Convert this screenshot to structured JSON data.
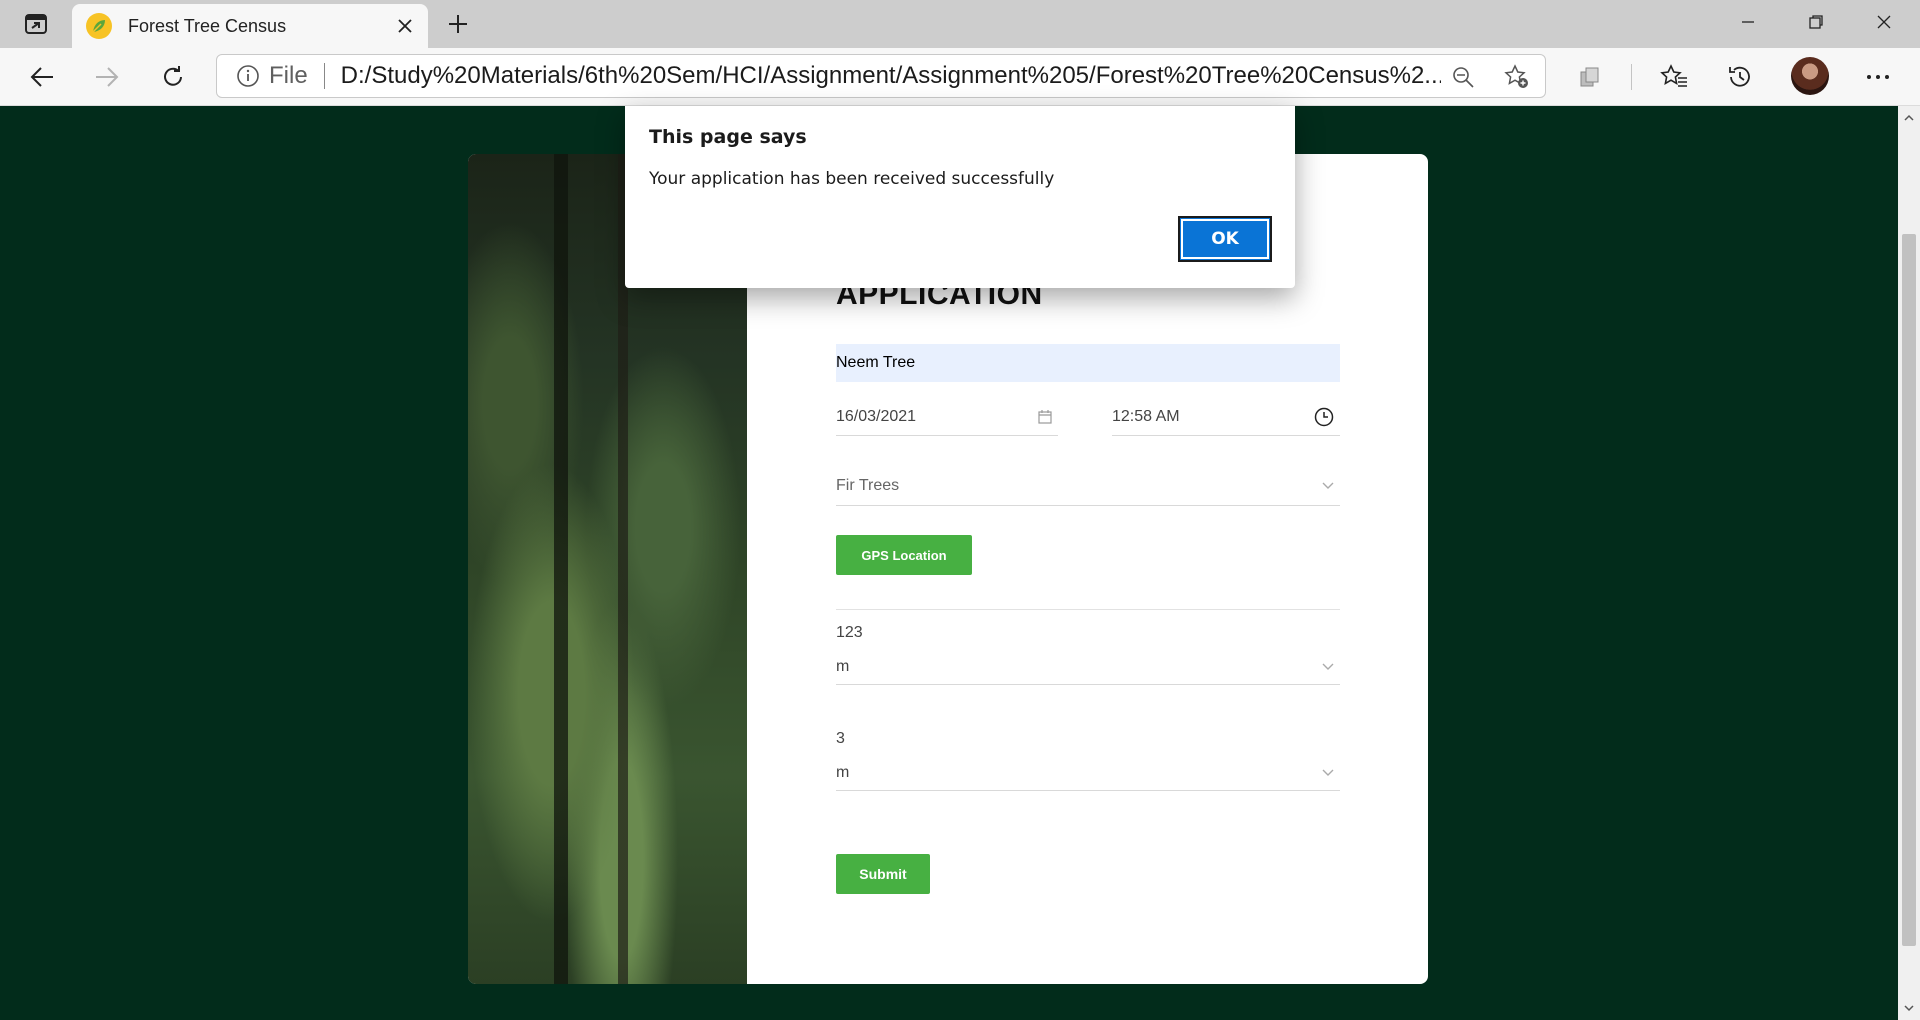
{
  "browser": {
    "tab_title": "Forest Tree Census",
    "address_prefix": "File",
    "url": "D:/Study%20Materials/6th%20Sem/HCI/Assignment/Assignment%205/Forest%20Tree%20Census%2..."
  },
  "form": {
    "heading": "APPLICATION",
    "tree_name": "Neem Tree",
    "date": "16/03/2021",
    "time": "12:58 AM",
    "species": "Fir Trees",
    "gps_button": "GPS Location",
    "height_value": "123",
    "height_unit": "m",
    "diameter_value": "3",
    "diameter_unit": "m",
    "submit_button": "Submit"
  },
  "dialog": {
    "title": "This page says",
    "message": "Your application has been received successfully",
    "ok_label": "OK"
  },
  "icons": {
    "app_menu": "tab-actions-icon",
    "favicon": "leaf-icon",
    "close": "close-icon",
    "new_tab": "plus-icon",
    "back": "back-arrow-icon",
    "forward": "forward-arrow-icon",
    "refresh": "refresh-icon",
    "info": "info-icon",
    "zoom": "zoom-out-icon",
    "favorite": "add-favorite-icon",
    "collections": "collections-icon",
    "favorites": "favorites-icon",
    "history": "history-icon",
    "more": "more-icon"
  },
  "colors": {
    "page_background": "#022c1b",
    "button_green": "#47b042",
    "dialog_ok": "#0a74d6",
    "autofill_background": "#e8f0fe"
  }
}
